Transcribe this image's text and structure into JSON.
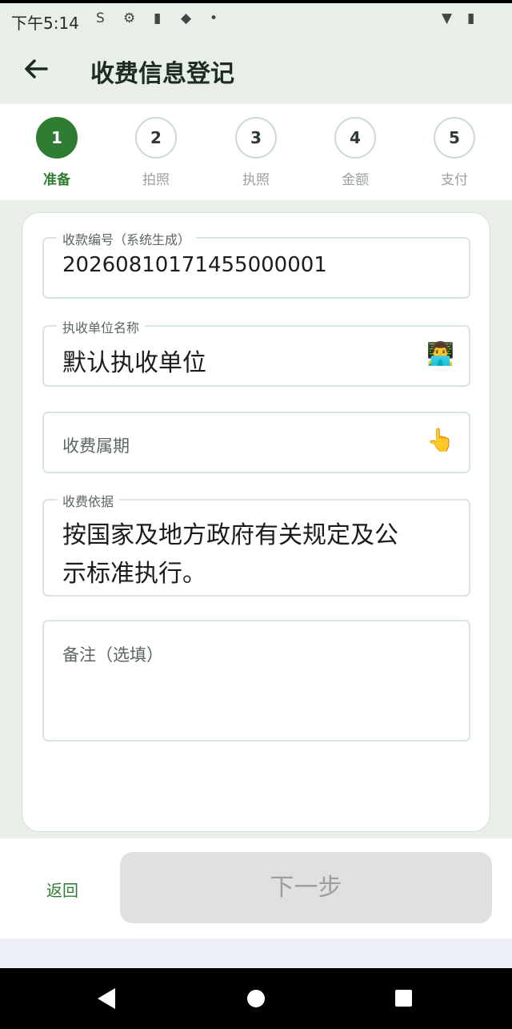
{
  "status_bar": {
    "time": "下午5:14",
    "icons": [
      "sync-icon",
      "settings-icon",
      "sim-card-icon",
      "notification-icon",
      "dot-icon",
      "wifi-icon",
      "battery-icon"
    ],
    "icon_glyphs": {
      "sync": "S",
      "settings": "⚙",
      "sim": "▮",
      "notification": "◆",
      "dot": "•",
      "wifi": "▼",
      "battery": "▮"
    }
  },
  "app_bar": {
    "back_icon": "arrow-left-icon",
    "title": "收费信息登记"
  },
  "stepper": {
    "steps": [
      {
        "number": "1",
        "label": "准备",
        "active": true
      },
      {
        "number": "2",
        "label": "拍照",
        "active": false
      },
      {
        "number": "3",
        "label": "执照",
        "active": false
      },
      {
        "number": "4",
        "label": "金额",
        "active": false
      },
      {
        "number": "5",
        "label": "支付",
        "active": false
      }
    ],
    "active_color": "#2e7d32"
  },
  "form": {
    "receipt_no": {
      "label": "收款编号（系统生成）",
      "value": "20260810171455000001"
    },
    "unit_name": {
      "label": "执收单位名称",
      "value": "默认执收单位",
      "icon": "person-at-computer-icon",
      "icon_glyph": "👨‍💻"
    },
    "period": {
      "placeholder": "收费属期",
      "icon": "pointing-hand-icon",
      "icon_glyph": "👆"
    },
    "basis": {
      "label": "收费依据",
      "value_line1": "按国家及地方政府有关规定及公",
      "value_line2": "示标准执行。"
    },
    "remark": {
      "placeholder": "备注（选填）"
    }
  },
  "footer": {
    "back_label": "返回",
    "next_label": "下一步"
  },
  "colors": {
    "accent": "#2e7d32",
    "page_bg": "#e8efe9",
    "disabled_button_bg": "#e0e0e0",
    "disabled_button_text": "#9e9e9e"
  }
}
